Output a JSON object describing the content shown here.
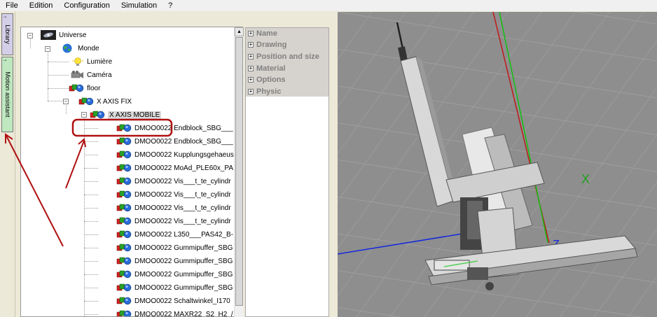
{
  "menu": [
    "File",
    "Edition",
    "Configuration",
    "Simulation",
    "?"
  ],
  "side_tabs": {
    "library": "Library",
    "motion_assistant": "Motion assistant"
  },
  "tree": {
    "root": "Universe",
    "monde": "Monde",
    "items": [
      "Lumière",
      "Caméra",
      "floor"
    ],
    "x_axis_fix": "X AXIS FIX",
    "x_axis_mobile": "X AXIS MOBILE",
    "parts": [
      "DMOO0022 Endblock_SBG___",
      "DMOO0022 Endblock_SBG___",
      "DMOO0022 Kupplungsgehaeus",
      "DMOO0022 MoAd_PLE60x_PA",
      "DMOO0022 Vis___t_te_cylindr",
      "DMOO0022 Vis___t_te_cylindr",
      "DMOO0022 Vis___t_te_cylindr",
      "DMOO0022 Vis___t_te_cylindr",
      "DMOO0022 L350___PAS42_B-",
      "DMOO0022 Gummipuffer_SBG",
      "DMOO0022 Gummipuffer_SBG",
      "DMOO0022 Gummipuffer_SBG",
      "DMOO0022 Gummipuffer_SBG",
      "DMOO0022 Schaltwinkel_I170",
      "DMOO0022 MAXR22_S2_H2_/"
    ]
  },
  "properties": [
    "Name",
    "Drawing",
    "Position and size",
    "Material",
    "Options",
    "Physic"
  ],
  "viewport": {
    "axis_x": "X",
    "axis_z": "Z",
    "colors": {
      "x": "#c01818",
      "y": "#10c010",
      "z": "#1428e0",
      "annotation": "#b01010"
    }
  }
}
